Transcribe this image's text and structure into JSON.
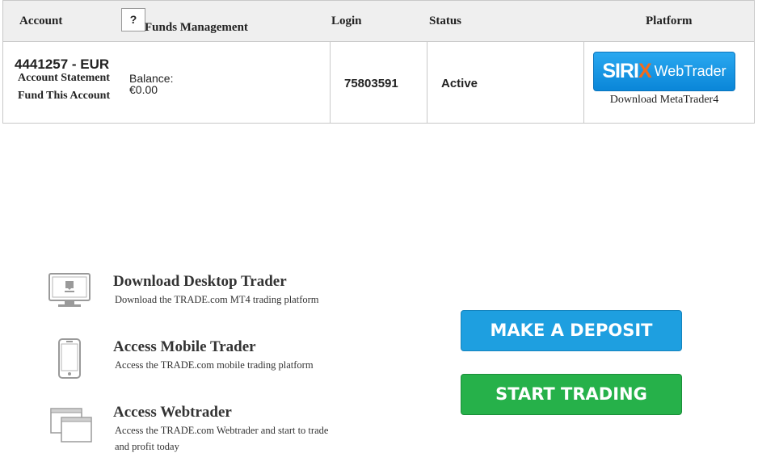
{
  "table": {
    "headers": {
      "account": "Account",
      "help": "?",
      "funds": "Funds Management",
      "login": "Login",
      "status": "Status",
      "platform": "Platform"
    },
    "row": {
      "account_number": "4441257 - EUR",
      "statement_link": "Account Statement",
      "fund_link": "Fund This Account",
      "balance_label": "Balance:",
      "balance_value": "€0.00",
      "login": "75803591",
      "status": "Active",
      "platform_button": {
        "logo_part1": "SIRI",
        "logo_x": "X",
        "logo_part2": "WebTrader"
      },
      "download_link": "Download MetaTrader4"
    }
  },
  "promos": [
    {
      "icon": "desktop-download-icon",
      "title": "Download Desktop Trader",
      "desc": "Download the TRADE.com MT4 trading platform"
    },
    {
      "icon": "mobile-phone-icon",
      "title": "Access Mobile Trader",
      "desc": "Access the TRADE.com mobile trading platform"
    },
    {
      "icon": "browser-windows-icon",
      "title": "Access Webtrader",
      "desc_line1": "Access the TRADE.com Webtrader and start to trade",
      "desc_line2": "and profit today"
    }
  ],
  "buttons": {
    "deposit": "MAKE A DEPOSIT",
    "trade": "START TRADING"
  },
  "colors": {
    "header_bg": "#efefef",
    "deposit_blue": "#1e9fe0",
    "trade_green": "#26b14a",
    "sirix_blue": "#0a86d8",
    "sirix_orange": "#f26b1d"
  }
}
